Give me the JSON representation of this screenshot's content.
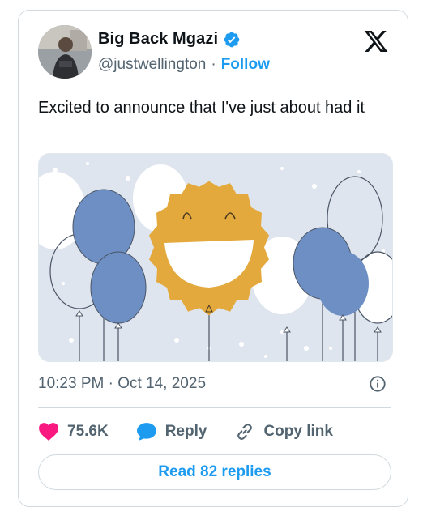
{
  "author": {
    "display_name": "Big Back Mgazi",
    "handle": "@justwellington",
    "separator": "·",
    "follow_label": "Follow",
    "verified": true
  },
  "tweet": {
    "text": "Excited to announce that I've just about had it",
    "time": "10:23 PM · Oct 14, 2025"
  },
  "media": {
    "description_icon": "smiley-balloon-celebration-image"
  },
  "actions": {
    "likes_count": "75.6K",
    "reply_label": "Reply",
    "copy_link_label": "Copy link"
  },
  "footer": {
    "read_replies_label": "Read 82 replies"
  },
  "colors": {
    "brand_blue": "#1d9bf0",
    "like_pink": "#f91880",
    "text_primary": "#0f1419",
    "text_secondary": "#536471",
    "balloon_blue": "#6e8fc4",
    "balloon_gold": "#e3a93c"
  },
  "icons": [
    "verified-badge-icon",
    "x-logo-icon",
    "info-icon",
    "heart-icon",
    "reply-bubble-icon",
    "link-icon"
  ]
}
